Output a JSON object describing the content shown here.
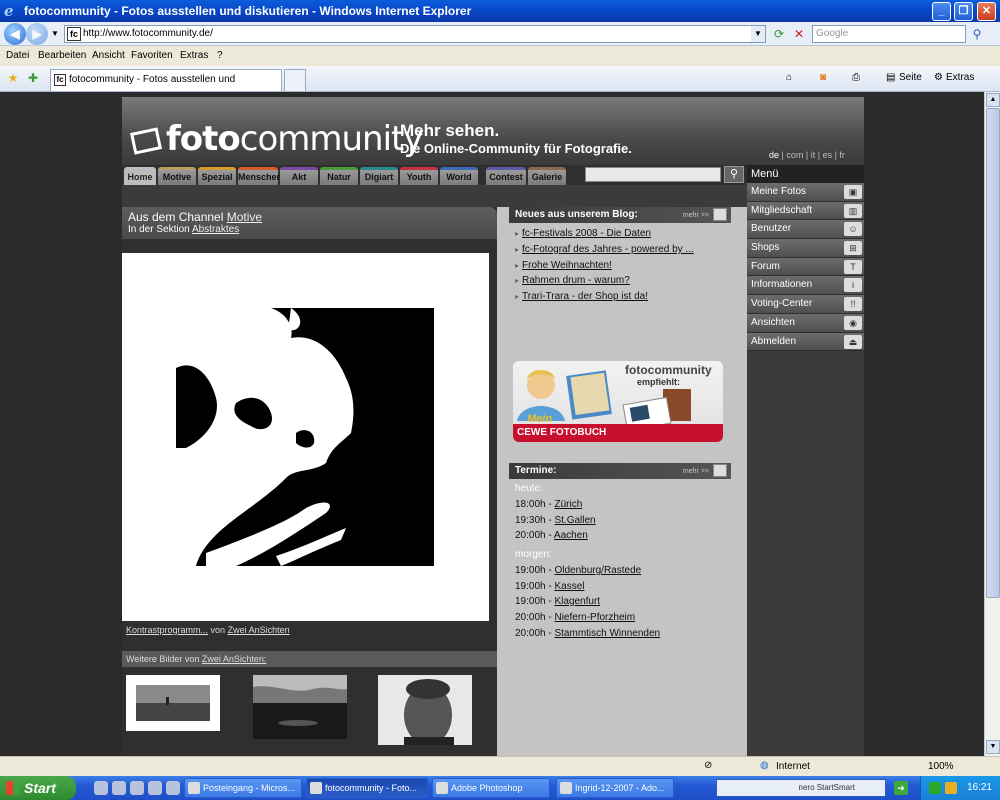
{
  "window": {
    "title": "fotocommunity - Fotos ausstellen und diskutieren - Windows Internet Explorer"
  },
  "address": {
    "url": "http://www.fotocommunity.de/",
    "search_placeholder": "Google"
  },
  "menu": [
    "Datei",
    "Bearbeiten",
    "Ansicht",
    "Favoriten",
    "Extras",
    "?"
  ],
  "tab": {
    "title": "fotocommunity - Fotos ausstellen und diskutieren"
  },
  "toolbar": {
    "page": "Seite",
    "tools": "Extras"
  },
  "site": {
    "logo_a": "foto",
    "logo_b": "community",
    "tagline1": "Mehr sehen.",
    "tagline2": "Die Online-Community für Fotografie.",
    "langs": {
      "de": "de",
      "com": "com",
      "it": "it",
      "es": "es",
      "fr": "fr"
    },
    "nav": [
      "Home",
      "Motive",
      "Spezial",
      "Menschen",
      "Akt",
      "Natur",
      "Digiart",
      "Youth",
      "World",
      "Contest",
      "Galerie"
    ],
    "nav_colors": [
      "#bdbdbd",
      "#b8a060",
      "#d89a28",
      "#d85a28",
      "#7a4aa8",
      "#4a9a3a",
      "#2a8a8a",
      "#c83040",
      "#3a6ab8",
      "#5a5aa8",
      "#8a6a4a"
    ],
    "side_menu": {
      "title": "Menü",
      "items": [
        "Meine Fotos",
        "Mitgliedschaft",
        "Benutzer",
        "Shops",
        "Forum",
        "Informationen",
        "Voting-Center",
        "Ansichten",
        "Abmelden"
      ]
    },
    "channel": {
      "prefix": "Aus dem Channel",
      "channel_name": "Motive",
      "section_prefix": "In der Sektion",
      "section_name": "Abstraktes"
    },
    "credit": {
      "title": "Kontrastprogramm...",
      "by": "von",
      "author": "Zwei AnSichten"
    },
    "more": {
      "prefix": "Weitere Bilder von",
      "author": "Zwei AnSichten:"
    },
    "blog": {
      "title": "Neues aus unserem Blog:",
      "more": "mehr >>",
      "items": [
        "fc-Festivals 2008 - Die Daten",
        "fc-Fotograf des Jahres - powered by ...",
        "Frohe Weihnachten!",
        "Rahmen drum - warum?",
        "Trari-Trara - der Shop ist da!"
      ]
    },
    "banner": {
      "brand": "fotocommunity",
      "recommends": "empfiehlt:",
      "product1": "Mein",
      "product2": "CEWE FOTOBUCH"
    },
    "events": {
      "title": "Termine:",
      "more": "mehr >>",
      "today_label": "heute:",
      "today": [
        {
          "time": "18:00h - ",
          "place": "Zürich"
        },
        {
          "time": "19:30h - ",
          "place": "St.Gallen"
        },
        {
          "time": "20:00h - ",
          "place": "Aachen"
        }
      ],
      "tomorrow_label": "morgen:",
      "tomorrow": [
        {
          "time": "19:00h - ",
          "place": "Oldenburg/Rastede"
        },
        {
          "time": "19:00h - ",
          "place": "Kassel"
        },
        {
          "time": "19:00h - ",
          "place": "Klagenfurt"
        },
        {
          "time": "20:00h - ",
          "place": "Niefern-Pforzheim"
        },
        {
          "time": "20:00h - ",
          "place": "Stammtisch Winnenden"
        }
      ]
    }
  },
  "status": {
    "zone": "Internet",
    "zoom": "100%"
  },
  "taskbar": {
    "start": "Start",
    "tasks": [
      "Posteingang - Micros...",
      "fotocommunity - Foto...",
      "Adobe Photoshop",
      "Ingrid-12-2007 - Ado..."
    ],
    "nero": "nero StartSmart",
    "clock": "16:21"
  }
}
